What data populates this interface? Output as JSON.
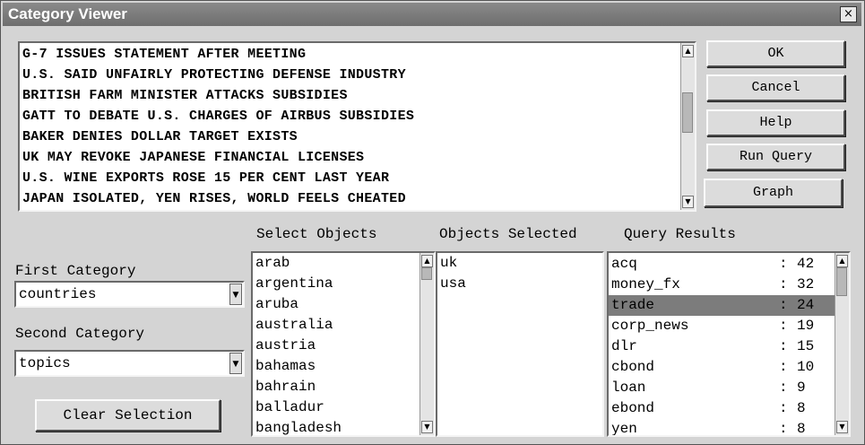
{
  "window": {
    "title": "Category Viewer",
    "close_glyph": "×"
  },
  "headlines": [
    "G-7 ISSUES STATEMENT AFTER MEETING",
    "U.S. SAID UNFAIRLY PROTECTING DEFENSE INDUSTRY",
    "BRITISH FARM MINISTER ATTACKS SUBSIDIES",
    "GATT TO DEBATE U.S. CHARGES OF AIRBUS SUBSIDIES",
    "BAKER DENIES DOLLAR TARGET EXISTS",
    "UK MAY REVOKE JAPANESE FINANCIAL LICENSES",
    "U.S. WINE EXPORTS ROSE 15 PER CENT LAST YEAR",
    "JAPAN ISOLATED, YEN RISES, WORLD FEELS CHEATED"
  ],
  "buttons": {
    "ok": "OK",
    "cancel": "Cancel",
    "help": "Help",
    "run_query": "Run Query",
    "graph": "Graph",
    "clear_selection": "Clear Selection"
  },
  "labels": {
    "first_category": "First Category",
    "second_category": "Second Category",
    "select_objects": "Select Objects",
    "objects_selected": "Objects Selected",
    "query_results": "Query Results"
  },
  "first_category": {
    "value": "countries"
  },
  "second_category": {
    "value": "topics"
  },
  "select_objects": [
    "arab",
    "argentina",
    "aruba",
    "australia",
    "austria",
    "bahamas",
    "bahrain",
    "balladur",
    "bangladesh"
  ],
  "objects_selected": [
    "uk",
    "usa"
  ],
  "query_results": [
    {
      "name": "acq",
      "count": "42"
    },
    {
      "name": "money_fx",
      "count": "32"
    },
    {
      "name": "trade",
      "count": "24",
      "selected": true
    },
    {
      "name": "corp_news",
      "count": "19"
    },
    {
      "name": "dlr",
      "count": "15"
    },
    {
      "name": "cbond",
      "count": "10"
    },
    {
      "name": "loan",
      "count": "9"
    },
    {
      "name": "ebond",
      "count": "8"
    },
    {
      "name": "yen",
      "count": "8"
    }
  ],
  "query_separator": ":",
  "icons": {
    "scroll_up": "up-arrow-icon",
    "scroll_down": "down-arrow-icon",
    "dropdown": "dropdown-arrow-icon",
    "close": "close-icon"
  }
}
